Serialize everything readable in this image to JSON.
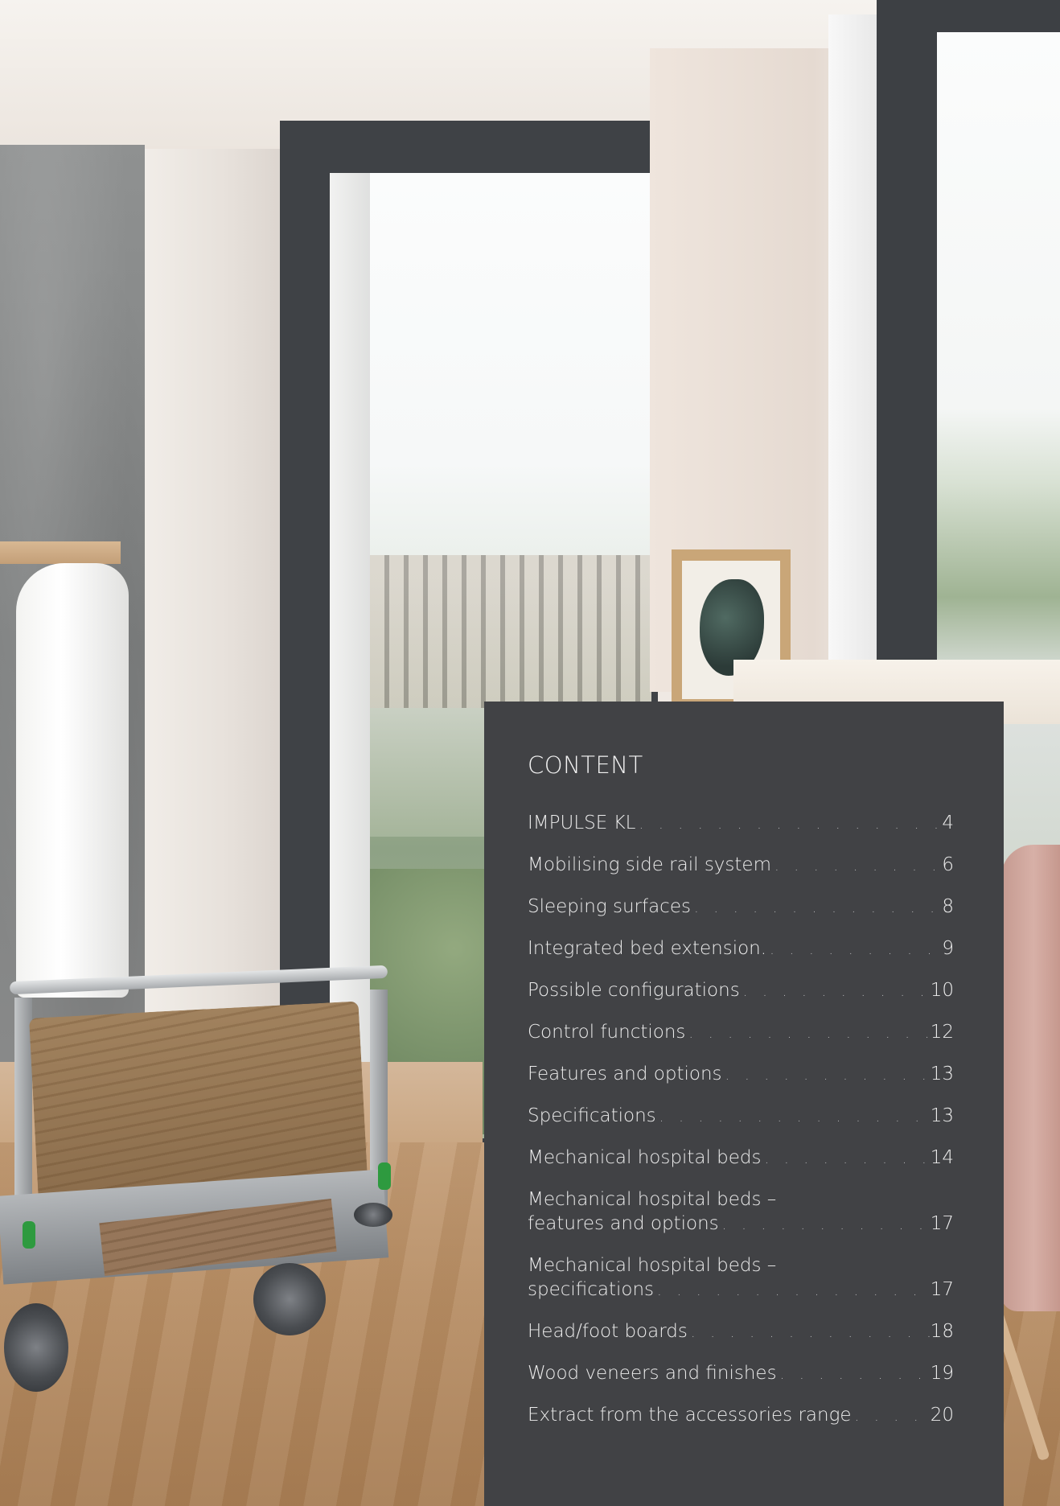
{
  "content_panel": {
    "title": "CONTENT",
    "entries": [
      {
        "label": "IMPULSE KL",
        "page": "4"
      },
      {
        "label": "Mobilising side rail system",
        "page": "6"
      },
      {
        "label": "Sleeping surfaces",
        "page": "8"
      },
      {
        "label": "Integrated bed extension.",
        "page": "9"
      },
      {
        "label": "Possible configurations",
        "page": "10"
      },
      {
        "label": "Control functions",
        "page": "12"
      },
      {
        "label": "Features and options",
        "page": "13"
      },
      {
        "label": "Specifications",
        "page": "13"
      },
      {
        "label": "Mechanical hospital beds",
        "page": "14"
      },
      {
        "label_line1": "Mechanical hospital beds –",
        "label": "features and options",
        "page": "17"
      },
      {
        "label_line1": "Mechanical hospital beds –",
        "label": "specifications",
        "page": "17"
      },
      {
        "label": "Head/foot boards",
        "page": "18"
      },
      {
        "label": "Wood veneers and finishes",
        "page": "19"
      },
      {
        "label": "Extract from the accessories range",
        "page": "20"
      }
    ]
  },
  "colors": {
    "panel_background": "#414245",
    "panel_text": "#ececec"
  }
}
